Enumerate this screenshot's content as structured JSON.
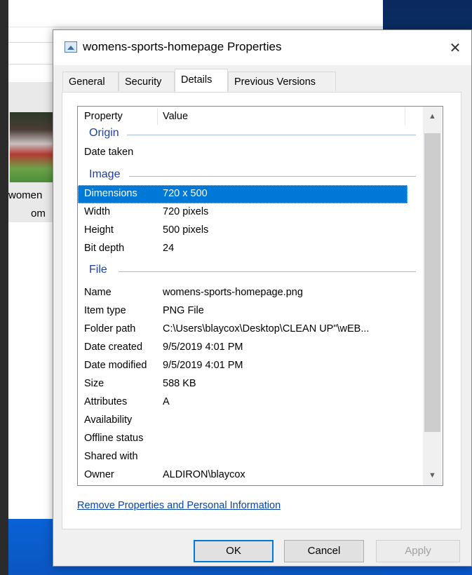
{
  "background": {
    "thumbnail_name_line1": "women",
    "thumbnail_name_line2": "om"
  },
  "dialog": {
    "title": "womens-sports-homepage Properties",
    "close_label": "✕",
    "tabs": [
      {
        "label": "General"
      },
      {
        "label": "Security"
      },
      {
        "label": "Details",
        "active": true
      },
      {
        "label": "Previous Versions"
      }
    ],
    "details": {
      "columns": {
        "property": "Property",
        "value": "Value"
      },
      "groups": [
        {
          "label": "Origin",
          "rows": [
            {
              "property": "Date taken",
              "value": ""
            }
          ]
        },
        {
          "label": "Image",
          "rows": [
            {
              "property": "Dimensions",
              "value": "720 x 500",
              "selected": true
            },
            {
              "property": "Width",
              "value": "720 pixels"
            },
            {
              "property": "Height",
              "value": "500 pixels"
            },
            {
              "property": "Bit depth",
              "value": "24"
            }
          ]
        },
        {
          "label": "File",
          "rows": [
            {
              "property": "Name",
              "value": "womens-sports-homepage.png"
            },
            {
              "property": "Item type",
              "value": "PNG File"
            },
            {
              "property": "Folder path",
              "value": "C:\\Users\\blaycox\\Desktop\\CLEAN UP\"\\wEB..."
            },
            {
              "property": "Date created",
              "value": "9/5/2019 4:01 PM"
            },
            {
              "property": "Date modified",
              "value": "9/5/2019 4:01 PM"
            },
            {
              "property": "Size",
              "value": "588 KB"
            },
            {
              "property": "Attributes",
              "value": "A"
            },
            {
              "property": "Availability",
              "value": ""
            },
            {
              "property": "Offline status",
              "value": ""
            },
            {
              "property": "Shared with",
              "value": ""
            },
            {
              "property": "Owner",
              "value": "ALDIRON\\blaycox"
            }
          ]
        }
      ],
      "scroll_up_icon": "▲",
      "scroll_down_icon": "▼"
    },
    "remove_link": "Remove Properties and Personal Information",
    "buttons": {
      "ok": "OK",
      "cancel": "Cancel",
      "apply": "Apply"
    }
  }
}
